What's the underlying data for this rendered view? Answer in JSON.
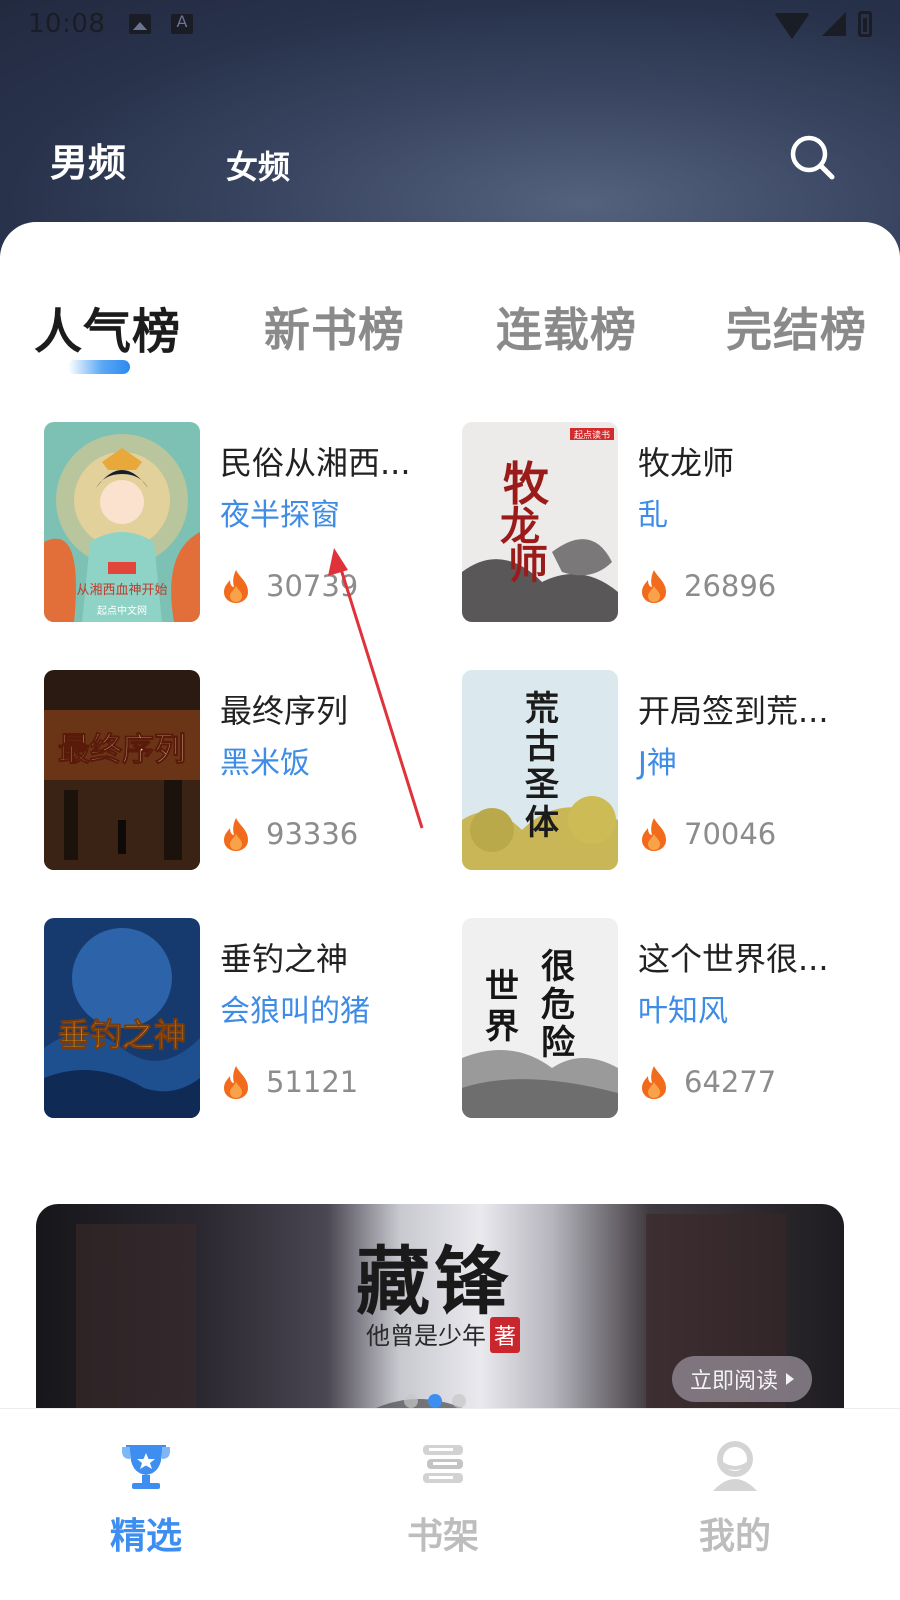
{
  "status_bar": {
    "time": "10:08"
  },
  "gender_tabs": [
    {
      "label": "男频",
      "active": true
    },
    {
      "label": "女频",
      "active": false
    }
  ],
  "rank_tabs": [
    {
      "label": "人气榜",
      "active": true
    },
    {
      "label": "新书榜",
      "active": false
    },
    {
      "label": "连载榜",
      "active": false
    },
    {
      "label": "完结榜",
      "active": false
    }
  ],
  "books": [
    {
      "title": "民俗从湘西...",
      "author": "夜半探窗",
      "heat": "30739",
      "cover_text": "从湘西血神开始",
      "cover_publisher": "起点中文网"
    },
    {
      "title": "牧龙师",
      "author": "乱",
      "heat": "26896",
      "cover_text": "牧龙师",
      "cover_publisher": "起点读书"
    },
    {
      "title": "最终序列",
      "author": "黑米饭",
      "heat": "93336",
      "cover_text": "最终序列",
      "cover_publisher": ""
    },
    {
      "title": "开局签到荒...",
      "author": "J神",
      "heat": "70046",
      "cover_text": "荒古圣体",
      "cover_publisher": ""
    },
    {
      "title": "垂钓之神",
      "author": "会狼叫的猪",
      "heat": "51121",
      "cover_text": "垂钓之神",
      "cover_publisher": ""
    },
    {
      "title": "这个世界很...",
      "author": "叶知风",
      "heat": "64277",
      "cover_text": "很危险",
      "cover_publisher": ""
    }
  ],
  "banner": {
    "title": "藏锋",
    "subtitle": "他曾是少年",
    "badge": "著",
    "button": "立即阅读",
    "slide_index": 2,
    "slide_count": 3
  },
  "bottom_nav": [
    {
      "label": "精选",
      "active": true,
      "icon": "trophy-icon"
    },
    {
      "label": "书架",
      "active": false,
      "icon": "bookshelf-icon"
    },
    {
      "label": "我的",
      "active": false,
      "icon": "profile-icon"
    }
  ],
  "colors": {
    "accent": "#3d8ef0",
    "author_blue": "#3e8ce6",
    "flame": "#f26a1b",
    "header_dark": "#28324b",
    "annotation_red": "#e0323a"
  }
}
